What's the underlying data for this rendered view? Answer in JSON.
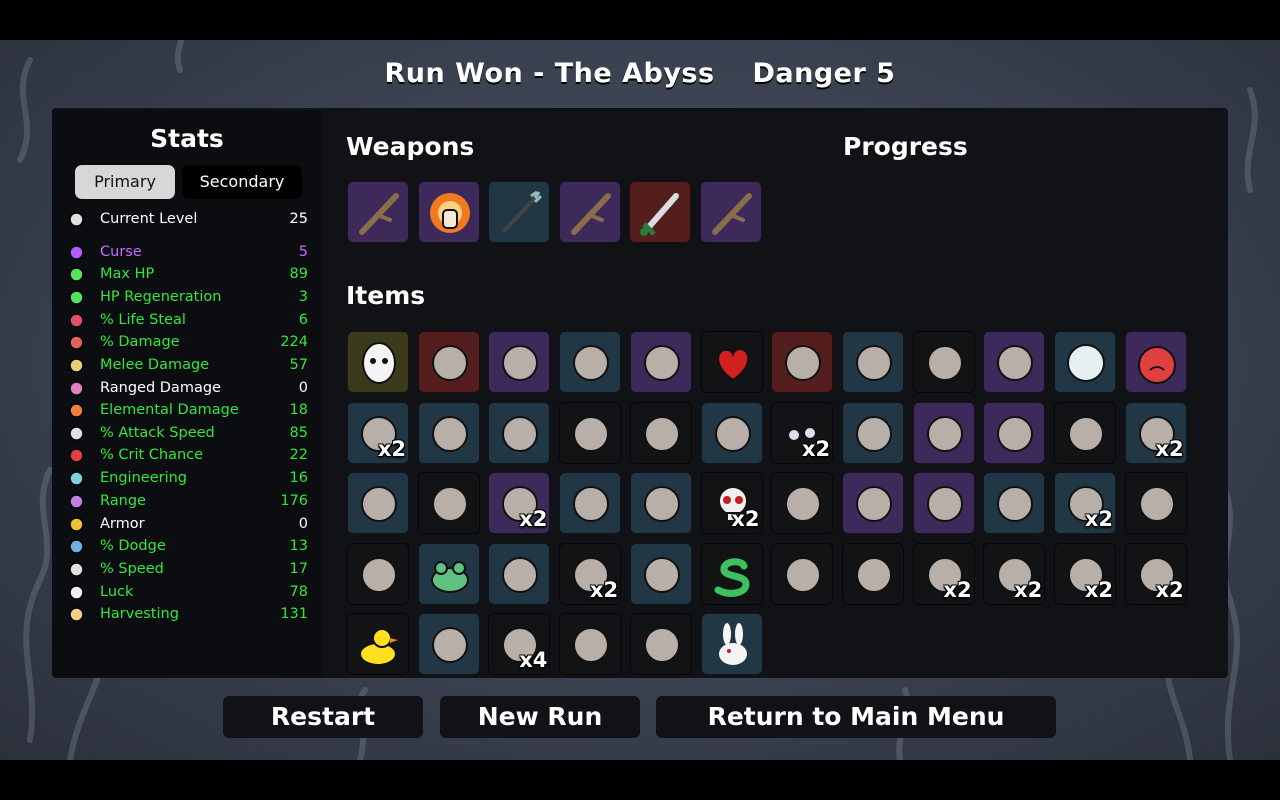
{
  "header": {
    "run_result": "Run Won - The Abyss",
    "danger": "Danger 5"
  },
  "stats": {
    "title": "Stats",
    "tabs": {
      "primary": "Primary",
      "secondary": "Secondary"
    },
    "rows": [
      {
        "label": "Current Level",
        "value": "25",
        "color": "#ffffff",
        "icon": "level-icon",
        "iconColor": "#e0e0e0"
      },
      {
        "label": "Curse",
        "value": "5",
        "color": "#c46cff",
        "icon": "curse-icon",
        "iconColor": "#b45bff"
      },
      {
        "label": "Max HP",
        "value": "89",
        "color": "#32e63c",
        "icon": "heart-icon",
        "iconColor": "#55e35f"
      },
      {
        "label": "HP Regeneration",
        "value": "3",
        "color": "#32e63c",
        "icon": "regen-icon",
        "iconColor": "#55e35f"
      },
      {
        "label": "% Life Steal",
        "value": "6",
        "color": "#32e63c",
        "icon": "life-steal-icon",
        "iconColor": "#e0506a"
      },
      {
        "label": "% Damage",
        "value": "224",
        "color": "#32e63c",
        "icon": "damage-icon",
        "iconColor": "#e06060"
      },
      {
        "label": "Melee Damage",
        "value": "57",
        "color": "#32e63c",
        "icon": "melee-icon",
        "iconColor": "#e8d070"
      },
      {
        "label": "Ranged Damage",
        "value": "0",
        "color": "#ffffff",
        "icon": "ranged-icon",
        "iconColor": "#e080c0"
      },
      {
        "label": "Elemental Damage",
        "value": "18",
        "color": "#32e63c",
        "icon": "elemental-icon",
        "iconColor": "#f08040"
      },
      {
        "label": "% Attack Speed",
        "value": "85",
        "color": "#32e63c",
        "icon": "attack-speed-icon",
        "iconColor": "#e0e0e0"
      },
      {
        "label": "% Crit Chance",
        "value": "22",
        "color": "#32e63c",
        "icon": "crit-icon",
        "iconColor": "#e04040"
      },
      {
        "label": "Engineering",
        "value": "16",
        "color": "#32e63c",
        "icon": "engineering-icon",
        "iconColor": "#80d0e0"
      },
      {
        "label": "Range",
        "value": "176",
        "color": "#32e63c",
        "icon": "range-icon",
        "iconColor": "#c080e0"
      },
      {
        "label": "Armor",
        "value": "0",
        "color": "#ffffff",
        "icon": "armor-icon",
        "iconColor": "#f0c030"
      },
      {
        "label": "% Dodge",
        "value": "13",
        "color": "#32e63c",
        "icon": "dodge-icon",
        "iconColor": "#70b0e0"
      },
      {
        "label": "% Speed",
        "value": "17",
        "color": "#32e63c",
        "icon": "speed-icon",
        "iconColor": "#e0e0e0"
      },
      {
        "label": "Luck",
        "value": "78",
        "color": "#32e63c",
        "icon": "luck-icon",
        "iconColor": "#f0f0f0"
      },
      {
        "label": "Harvesting",
        "value": "131",
        "color": "#32e63c",
        "icon": "harvesting-icon",
        "iconColor": "#f0d080"
      }
    ]
  },
  "weapons": {
    "title": "Weapons",
    "slots": [
      {
        "icon": "stick-icon",
        "tier": "purple"
      },
      {
        "icon": "flaming-fist-icon",
        "tier": "purple"
      },
      {
        "icon": "spear-icon",
        "tier": "blue"
      },
      {
        "icon": "stick-icon",
        "tier": "purple"
      },
      {
        "icon": "sword-icon",
        "tier": "red"
      },
      {
        "icon": "stick-icon",
        "tier": "purple"
      }
    ]
  },
  "progress": {
    "title": "Progress"
  },
  "items": {
    "title": "Items",
    "slots": [
      {
        "icon": "egg-face-icon",
        "tier": "olive",
        "count": ""
      },
      {
        "icon": "zombie-head-icon",
        "tier": "red",
        "count": ""
      },
      {
        "icon": "cannon-icon",
        "tier": "purple",
        "count": ""
      },
      {
        "icon": "black-balls-icon",
        "tier": "blue",
        "count": ""
      },
      {
        "icon": "bottle-icon",
        "tier": "purple",
        "count": ""
      },
      {
        "icon": "red-heart-icon",
        "tier": "black",
        "count": ""
      },
      {
        "icon": "helmet-icon",
        "tier": "red",
        "count": ""
      },
      {
        "icon": "leather-vest-icon",
        "tier": "blue",
        "count": ""
      },
      {
        "icon": "bat-icon",
        "tier": "black",
        "count": ""
      },
      {
        "icon": "mushrooms-icon",
        "tier": "purple",
        "count": ""
      },
      {
        "icon": "crystal-ball-icon",
        "tier": "blue",
        "count": ""
      },
      {
        "icon": "tomato-face-icon",
        "tier": "purple",
        "count": ""
      },
      {
        "icon": "claws-icon",
        "tier": "blue",
        "count": "x2"
      },
      {
        "icon": "junk-pile-icon",
        "tier": "blue",
        "count": ""
      },
      {
        "icon": "worm-icon",
        "tier": "blue",
        "count": ""
      },
      {
        "icon": "syringe-icon",
        "tier": "black",
        "count": ""
      },
      {
        "icon": "tooth-icon",
        "tier": "black",
        "count": ""
      },
      {
        "icon": "medkit-robot-icon",
        "tier": "blue",
        "count": ""
      },
      {
        "icon": "eyes-icon",
        "tier": "black",
        "count": "x2"
      },
      {
        "icon": "red-ring-icon",
        "tier": "blue",
        "count": ""
      },
      {
        "icon": "tardigrade-icon",
        "tier": "purple",
        "count": ""
      },
      {
        "icon": "starfish-icon",
        "tier": "purple",
        "count": ""
      },
      {
        "icon": "snail-shell-icon",
        "tier": "black",
        "count": ""
      },
      {
        "icon": "grenade-icon",
        "tier": "blue",
        "count": "x2"
      },
      {
        "icon": "cocoon-icon",
        "tier": "blue",
        "count": ""
      },
      {
        "icon": "lighthouse-icon",
        "tier": "black",
        "count": ""
      },
      {
        "icon": "crystal-icon",
        "tier": "purple",
        "count": "x2"
      },
      {
        "icon": "chain-ring-icon",
        "tier": "blue",
        "count": ""
      },
      {
        "icon": "potion-icon",
        "tier": "blue",
        "count": ""
      },
      {
        "icon": "skull-icon",
        "tier": "black",
        "count": "x2"
      },
      {
        "icon": "cauldron-icon",
        "tier": "black",
        "count": ""
      },
      {
        "icon": "mortar-icon",
        "tier": "purple",
        "count": ""
      },
      {
        "icon": "triangle-gem-icon",
        "tier": "purple",
        "count": ""
      },
      {
        "icon": "snail-icon",
        "tier": "blue",
        "count": ""
      },
      {
        "icon": "wasp-icon",
        "tier": "blue",
        "count": "x2"
      },
      {
        "icon": "thorns-icon",
        "tier": "black",
        "count": ""
      },
      {
        "icon": "fang-icon",
        "tier": "black",
        "count": ""
      },
      {
        "icon": "frog-icon",
        "tier": "blue",
        "count": ""
      },
      {
        "icon": "claw-shards-icon",
        "tier": "blue",
        "count": ""
      },
      {
        "icon": "red-beast-icon",
        "tier": "black",
        "count": "x2"
      },
      {
        "icon": "scarecrow-icon",
        "tier": "blue",
        "count": ""
      },
      {
        "icon": "snake-icon",
        "tier": "black",
        "count": ""
      },
      {
        "icon": "fish-icon",
        "tier": "black",
        "count": ""
      },
      {
        "icon": "ghost-icon",
        "tier": "black",
        "count": ""
      },
      {
        "icon": "goat-skull-icon",
        "tier": "black",
        "count": "x2"
      },
      {
        "icon": "rock-icon",
        "tier": "black",
        "count": "x2"
      },
      {
        "icon": "dagger-icon",
        "tier": "black",
        "count": "x2"
      },
      {
        "icon": "hedgehog-icon",
        "tier": "black",
        "count": "x2"
      },
      {
        "icon": "rubber-duck-icon",
        "tier": "black",
        "count": ""
      },
      {
        "icon": "clam-icon",
        "tier": "blue",
        "count": ""
      },
      {
        "icon": "propeller-hat-icon",
        "tier": "black",
        "count": "x4"
      },
      {
        "icon": "sack-icon",
        "tier": "black",
        "count": ""
      },
      {
        "icon": "flannel-shirt-icon",
        "tier": "black",
        "count": ""
      },
      {
        "icon": "rabbit-icon",
        "tier": "blue",
        "count": ""
      }
    ]
  },
  "buttons": {
    "restart": "Restart",
    "new_run": "New Run",
    "main_menu": "Return to Main Menu"
  },
  "tier_colors": {
    "purple": "#3e2a5a",
    "blue": "#223746",
    "red": "#541e1e",
    "black": "#121315",
    "olive": "#3c3a1c"
  }
}
